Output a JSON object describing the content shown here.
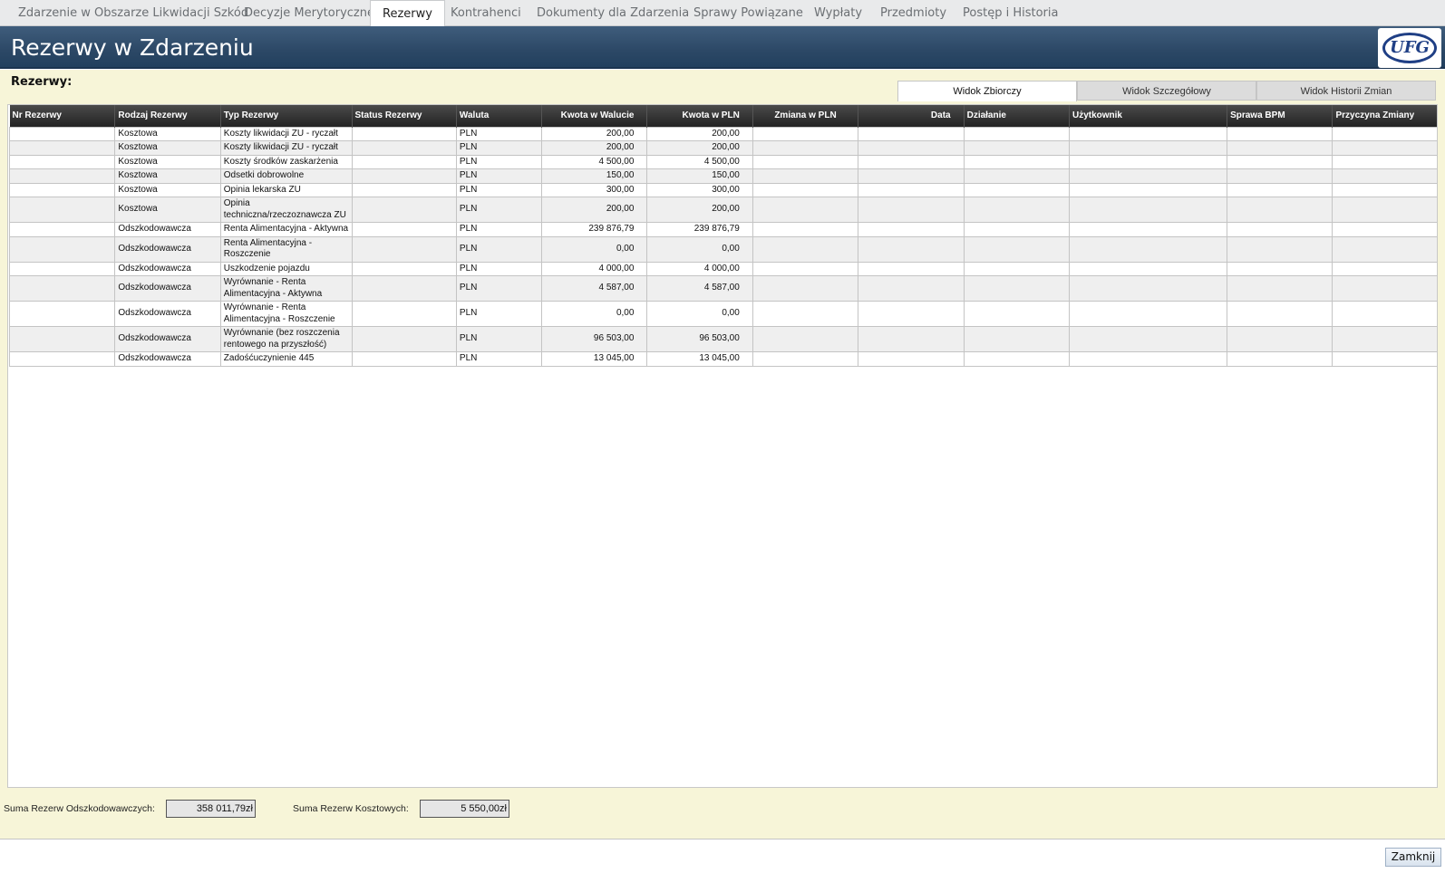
{
  "top_tabs": [
    {
      "label": "Zdarzenie w Obszarze Likwidacji Szkód"
    },
    {
      "label": "Decyzje Merytoryczne"
    },
    {
      "label": "Rezerwy"
    },
    {
      "label": "Kontrahenci"
    },
    {
      "label": "Dokumenty dla Zdarzenia"
    },
    {
      "label": "Sprawy Powiązane"
    },
    {
      "label": "Wypłaty"
    },
    {
      "label": "Przedmioty"
    },
    {
      "label": "Postęp i Historia"
    }
  ],
  "active_top_tab": "Rezerwy",
  "banner": {
    "title": "Rezerwy w Zdarzeniu",
    "logo_text": "UFG"
  },
  "section": {
    "heading": "Rezerwy:"
  },
  "view_tabs": [
    {
      "label": "Widok Zbiorczy"
    },
    {
      "label": "Widok Szczegółowy"
    },
    {
      "label": "Widok Historii Zmian"
    }
  ],
  "active_view_tab": "Widok Zbiorczy",
  "table": {
    "columns": [
      "Nr Rezerwy",
      "Rodzaj Rezerwy",
      "Typ Rezerwy",
      "Status Rezerwy",
      "Waluta",
      "Kwota w Walucie",
      "Kwota w PLN",
      "Zmiana w PLN",
      "Data",
      "Działanie",
      "Użytkownik",
      "Sprawa BPM",
      "Przyczyna Zmiany"
    ],
    "rows": [
      {
        "nr": "",
        "rodzaj": "Kosztowa",
        "typ": "Koszty likwidacji ZU - ryczałt",
        "status": "",
        "waluta": "PLN",
        "kwota_waluta": "200,00",
        "kwota_pln": "200,00",
        "zmiana": "",
        "data": "",
        "dzialanie": "",
        "uzytkownik": "",
        "sprawa": "",
        "przyczyna": ""
      },
      {
        "nr": "",
        "rodzaj": "Kosztowa",
        "typ": "Koszty likwidacji ZU - ryczałt",
        "status": "",
        "waluta": "PLN",
        "kwota_waluta": "200,00",
        "kwota_pln": "200,00",
        "zmiana": "",
        "data": "",
        "dzialanie": "",
        "uzytkownik": "",
        "sprawa": "",
        "przyczyna": ""
      },
      {
        "nr": "",
        "rodzaj": "Kosztowa",
        "typ": "Koszty środków zaskarżenia",
        "status": "",
        "waluta": "PLN",
        "kwota_waluta": "4 500,00",
        "kwota_pln": "4 500,00",
        "zmiana": "",
        "data": "",
        "dzialanie": "",
        "uzytkownik": "",
        "sprawa": "",
        "przyczyna": ""
      },
      {
        "nr": "",
        "rodzaj": "Kosztowa",
        "typ": "Odsetki dobrowolne",
        "status": "",
        "waluta": "PLN",
        "kwota_waluta": "150,00",
        "kwota_pln": "150,00",
        "zmiana": "",
        "data": "",
        "dzialanie": "",
        "uzytkownik": "",
        "sprawa": "",
        "przyczyna": ""
      },
      {
        "nr": "",
        "rodzaj": "Kosztowa",
        "typ": "Opinia lekarska ZU",
        "status": "",
        "waluta": "PLN",
        "kwota_waluta": "300,00",
        "kwota_pln": "300,00",
        "zmiana": "",
        "data": "",
        "dzialanie": "",
        "uzytkownik": "",
        "sprawa": "",
        "przyczyna": ""
      },
      {
        "nr": "",
        "rodzaj": "Kosztowa",
        "typ": "Opinia techniczna/rzeczoznawcza ZU",
        "status": "",
        "waluta": "PLN",
        "kwota_waluta": "200,00",
        "kwota_pln": "200,00",
        "zmiana": "",
        "data": "",
        "dzialanie": "",
        "uzytkownik": "",
        "sprawa": "",
        "przyczyna": ""
      },
      {
        "nr": "",
        "rodzaj": "Odszkodowawcza",
        "typ": "Renta Alimentacyjna - Aktywna",
        "status": "",
        "waluta": "PLN",
        "kwota_waluta": "239 876,79",
        "kwota_pln": "239 876,79",
        "zmiana": "",
        "data": "",
        "dzialanie": "",
        "uzytkownik": "",
        "sprawa": "",
        "przyczyna": ""
      },
      {
        "nr": "",
        "rodzaj": "Odszkodowawcza",
        "typ": "Renta Alimentacyjna - Roszczenie",
        "status": "",
        "waluta": "PLN",
        "kwota_waluta": "0,00",
        "kwota_pln": "0,00",
        "zmiana": "",
        "data": "",
        "dzialanie": "",
        "uzytkownik": "",
        "sprawa": "",
        "przyczyna": ""
      },
      {
        "nr": "",
        "rodzaj": "Odszkodowawcza",
        "typ": "Uszkodzenie pojazdu",
        "status": "",
        "waluta": "PLN",
        "kwota_waluta": "4 000,00",
        "kwota_pln": "4 000,00",
        "zmiana": "",
        "data": "",
        "dzialanie": "",
        "uzytkownik": "",
        "sprawa": "",
        "przyczyna": ""
      },
      {
        "nr": "",
        "rodzaj": "Odszkodowawcza",
        "typ": "Wyrównanie - Renta Alimentacyjna - Aktywna",
        "status": "",
        "waluta": "PLN",
        "kwota_waluta": "4 587,00",
        "kwota_pln": "4 587,00",
        "zmiana": "",
        "data": "",
        "dzialanie": "",
        "uzytkownik": "",
        "sprawa": "",
        "przyczyna": ""
      },
      {
        "nr": "",
        "rodzaj": "Odszkodowawcza",
        "typ": "Wyrównanie - Renta Alimentacyjna - Roszczenie",
        "status": "",
        "waluta": "PLN",
        "kwota_waluta": "0,00",
        "kwota_pln": "0,00",
        "zmiana": "",
        "data": "",
        "dzialanie": "",
        "uzytkownik": "",
        "sprawa": "",
        "przyczyna": ""
      },
      {
        "nr": "",
        "rodzaj": "Odszkodowawcza",
        "typ": "Wyrównanie (bez roszczenia rentowego na przyszłość)",
        "status": "",
        "waluta": "PLN",
        "kwota_waluta": "96 503,00",
        "kwota_pln": "96 503,00",
        "zmiana": "",
        "data": "",
        "dzialanie": "",
        "uzytkownik": "",
        "sprawa": "",
        "przyczyna": ""
      },
      {
        "nr": "",
        "rodzaj": "Odszkodowawcza",
        "typ": "Zadośćuczynienie 445",
        "status": "",
        "waluta": "PLN",
        "kwota_waluta": "13 045,00",
        "kwota_pln": "13 045,00",
        "zmiana": "",
        "data": "",
        "dzialanie": "",
        "uzytkownik": "",
        "sprawa": "",
        "przyczyna": ""
      }
    ]
  },
  "sums": {
    "odszkodowawcze_label": "Suma Rezerw Odszkodowawczych:",
    "odszkodowawcze_value": "358 011,79zł",
    "kosztowe_label": "Suma Rezerw Kosztowych:",
    "kosztowe_value": "5 550,00zł"
  },
  "buttons": {
    "close_label": "Zamknij"
  },
  "colors": {
    "banner": "#2c4866",
    "panel_bg": "#f7f5d8",
    "header_row": "#2b2b2b"
  }
}
